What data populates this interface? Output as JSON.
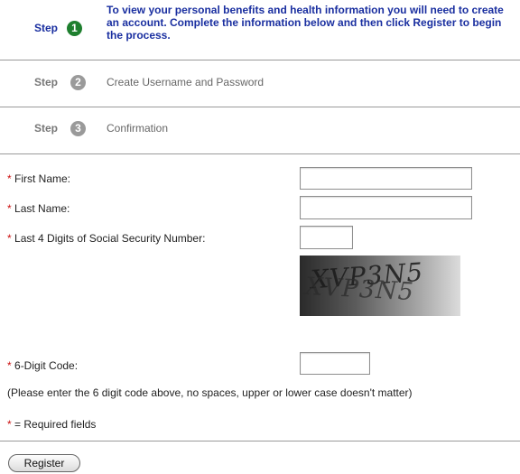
{
  "steps": [
    {
      "label": "Step",
      "number": "1",
      "text": "To view your personal benefits and health information you will need to create an account. Complete the information below and then click Register to begin the process.",
      "color": "#1e7f2e",
      "active": true
    },
    {
      "label": "Step",
      "number": "2",
      "text": "Create Username and Password",
      "color": "#9a9a9a",
      "active": false
    },
    {
      "label": "Step",
      "number": "3",
      "text": "Confirmation",
      "color": "#9a9a9a",
      "active": false
    }
  ],
  "colors": {
    "active_text": "#1a2fa0",
    "required_star": "#cc1111"
  },
  "form": {
    "required_marker": "*",
    "first_name_label": "First Name:",
    "last_name_label": "Last Name:",
    "ssn_label": "Last 4 Digits of Social Security Number:",
    "captcha_label": "6-Digit Code:",
    "captcha_text": "XVP3N5",
    "captcha_hint": "(Please enter the 6 digit code above, no spaces, upper or lower case doesn't matter)",
    "required_note": "= Required fields",
    "first_name_value": "",
    "last_name_value": "",
    "ssn_value": "",
    "captcha_value": ""
  },
  "register_label": "Register"
}
